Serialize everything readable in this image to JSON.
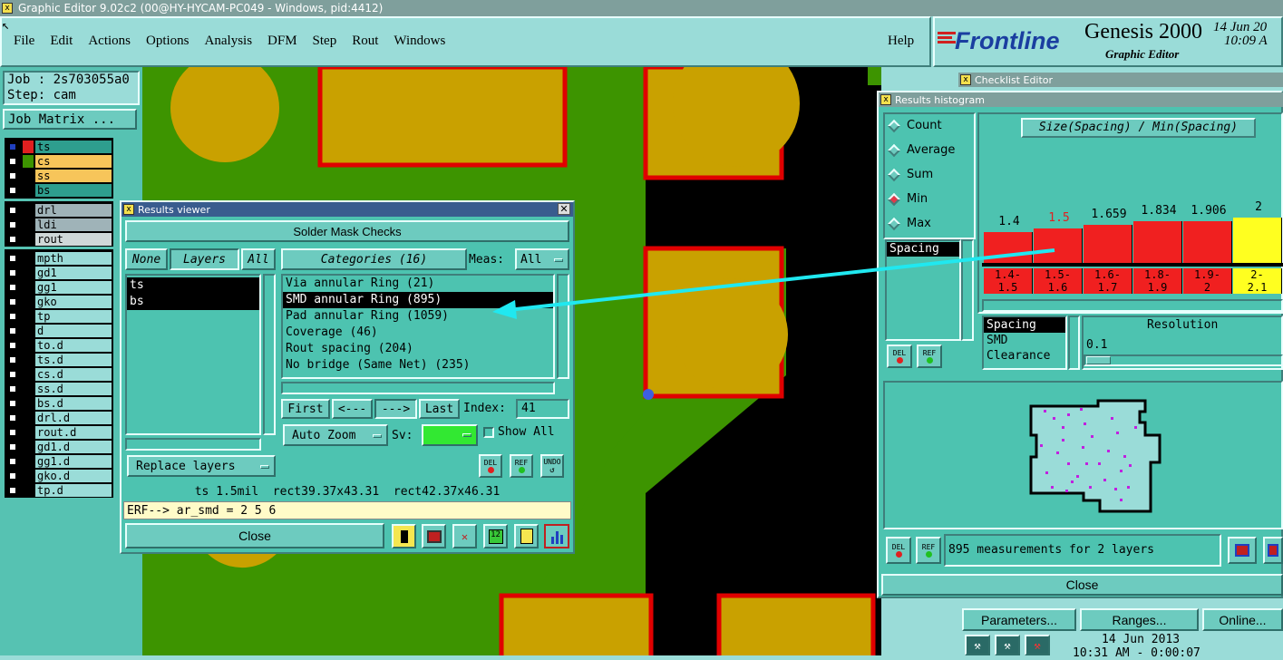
{
  "window": {
    "title": "Graphic Editor 9.02c2 (00@HY-HYCAM-PC049 - Windows, pid:4412)"
  },
  "menu": {
    "items": [
      "File",
      "Edit",
      "Actions",
      "Options",
      "Analysis",
      "DFM",
      "Step",
      "Rout",
      "Windows"
    ],
    "help": "Help"
  },
  "brand": {
    "logo": "Frontline",
    "product": "Genesis 2000",
    "subtitle": "Graphic Editor",
    "date": "14 Jun 20",
    "time": "10:09 A"
  },
  "job": {
    "job_label": "Job : 2s703055a0",
    "step_label": "Step: cam",
    "matrix_button": "Job Matrix ..."
  },
  "layers": {
    "board": [
      {
        "name": "ts",
        "color": "#2e9e8e"
      },
      {
        "name": "cs",
        "color": "#f7c55a"
      },
      {
        "name": "ss",
        "color": "#f7c55a"
      },
      {
        "name": "bs",
        "color": "#2e9e8e"
      }
    ],
    "drill": [
      {
        "name": "drl",
        "color": "#9fb3b8"
      },
      {
        "name": "ldi",
        "color": "#9fb3b8"
      },
      {
        "name": "rout",
        "color": "#cfd8d8"
      }
    ],
    "misc": [
      "mpth",
      "gd1",
      "gg1",
      "gko",
      "tp",
      "d",
      "to.d",
      "ts.d",
      "cs.d",
      "ss.d",
      "bs.d",
      "drl.d",
      "rout.d",
      "gd1.d",
      "gg1.d",
      "gko.d",
      "tp.d"
    ]
  },
  "results_viewer": {
    "title": "Results viewer",
    "header": "Solder Mask Checks",
    "none_button": "None",
    "layers_button": "Layers",
    "all_button": "All",
    "categories_button": "Categories (16)",
    "meas_label": "Meas:",
    "meas_value": "All",
    "layer_list": [
      "ts",
      "bs"
    ],
    "categories": [
      "Via annular Ring (21)",
      "SMD annular Ring (895)",
      "Pad annular Ring (1059)",
      "Coverage (46)",
      "Rout spacing (204)",
      "No bridge (Same Net) (235)"
    ],
    "first": "First",
    "prev": "<---",
    "next": "--->",
    "last": "Last",
    "index_label": "Index:",
    "index_value": "41",
    "auto_zoom": "Auto Zoom",
    "sv_label": "Sv:",
    "show_all": "Show All",
    "replace_layers": "Replace layers",
    "del": "DEL",
    "ref": "REF",
    "undo": "UNDO",
    "status": "ts 1.5mil  rect39.37x43.31  rect42.37x46.31",
    "erf": "ERF--> ar_smd = 2 5 6",
    "close": "Close"
  },
  "checklist_editor": {
    "title": "Checklist Editor"
  },
  "histogram": {
    "title": "Results histogram",
    "radios": [
      "Count",
      "Average",
      "Sum",
      "Min",
      "Max"
    ],
    "selected": "Min",
    "chart_title": "Size(Spacing) / Min(Spacing)",
    "bar_values": [
      "1.4",
      "1.5",
      "1.659",
      "1.834",
      "1.906",
      "2"
    ],
    "bins": [
      "1.4-\n1.5",
      "1.5-\n1.6",
      "1.6-\n1.7",
      "1.8-\n1.9",
      "1.9-\n2",
      "2-\n2.1"
    ],
    "list1": [
      "Spacing"
    ],
    "list2": [
      "Spacing",
      "SMD",
      "Clearance"
    ],
    "resolution_label": "Resolution",
    "resolution_value": "0.1",
    "del": "DEL",
    "ref": "REF",
    "measurements": "895 measurements for 2 layers",
    "close": "Close"
  },
  "bottom_panel": {
    "parameters": "Parameters...",
    "ranges": "Ranges...",
    "online": "Online...",
    "date": "14 Jun 2013",
    "time": "10:31 AM - 0:00:07"
  }
}
